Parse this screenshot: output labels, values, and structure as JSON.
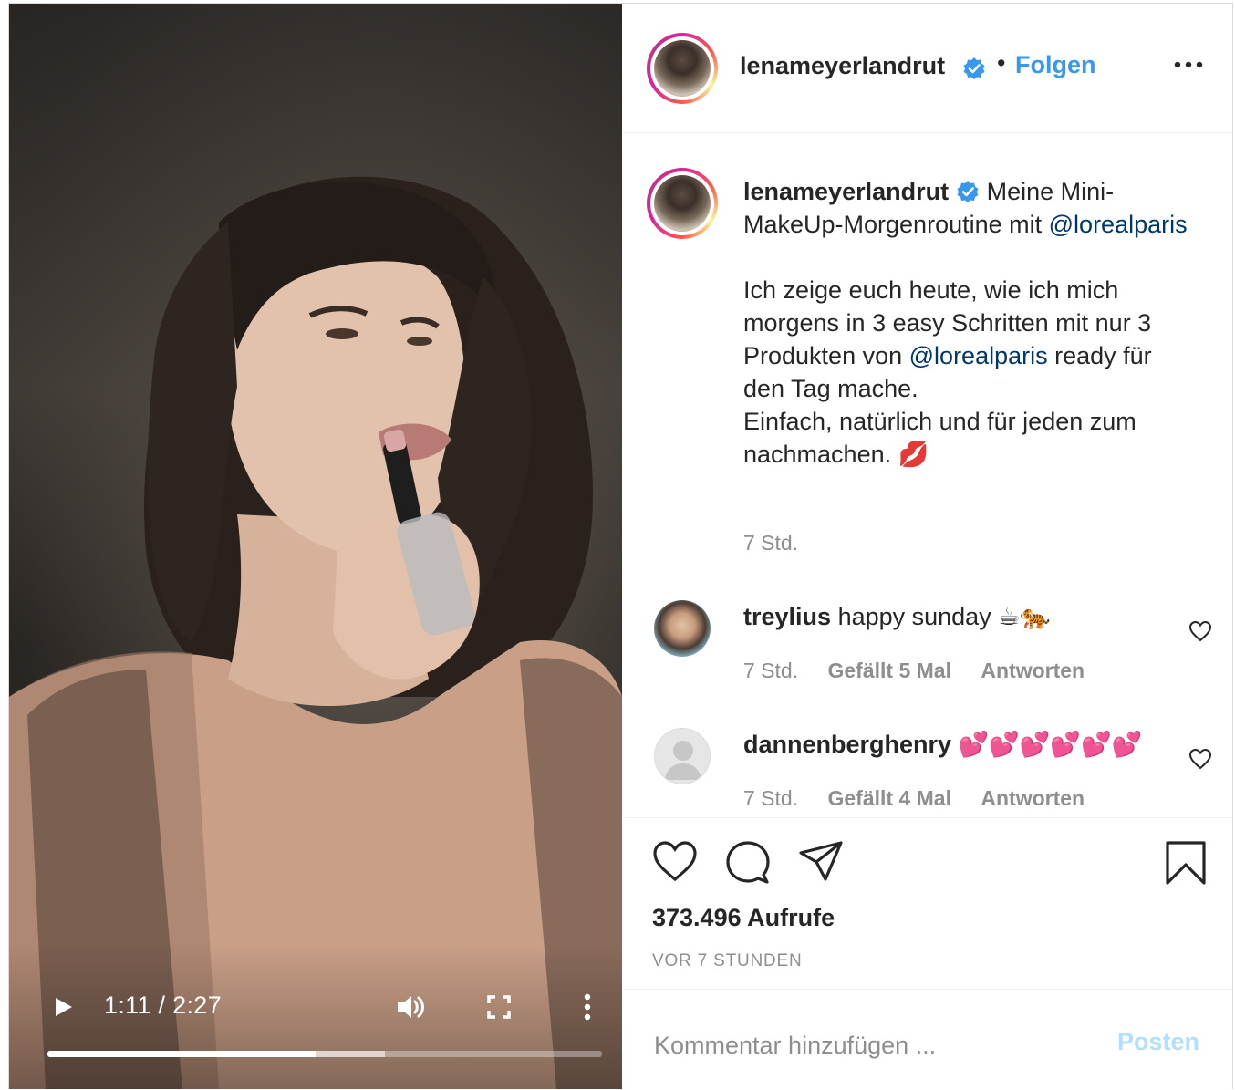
{
  "video": {
    "current_time": "1:11",
    "duration": "2:27",
    "time_display": "1:11 / 2:27",
    "progress_played": 0.484,
    "progress_buffered": 0.609
  },
  "header": {
    "username": "lenameyerlandrut",
    "dot": "•",
    "follow_label": "Folgen"
  },
  "caption": {
    "username": "lenameyerlandrut",
    "line1_before": "Meine Mini-MakeUp-Morgenroutine mit",
    "mention1": "@lorealparis",
    "body_before": "Ich zeige euch heute, wie ich mich morgens in 3 easy Schritten mit nur 3 Produkten von",
    "mention2": "@lorealparis",
    "body_after": "ready für den Tag mache.",
    "body_line2": "Einfach, natürlich und für jeden zum nachmachen. 💋",
    "time": "7 Std."
  },
  "comments": [
    {
      "username": "treylius",
      "text": "happy sunday ☕🐅",
      "time": "7 Std.",
      "likes": "Gefällt 5 Mal",
      "reply": "Antworten"
    },
    {
      "username": "dannenberghenry",
      "text": "💕💕💕💕💕💕",
      "time": "7 Std.",
      "likes": "Gefällt 4 Mal",
      "reply": "Antworten"
    }
  ],
  "stats": {
    "views": "373.496 Aufrufe",
    "ago": "VOR 7 STUNDEN"
  },
  "comment_box": {
    "placeholder": "Kommentar hinzufügen ...",
    "post_label": "Posten"
  },
  "colors": {
    "link_blue": "#3897f0",
    "mention_blue": "#00376b",
    "muted": "#8e8e8e",
    "post_disabled": "#b2dffc"
  },
  "icons": [
    "play-icon",
    "volume-icon",
    "fullscreen-icon",
    "more-vertical-icon",
    "verified-icon",
    "more-horizontal-icon",
    "heart-icon",
    "comment-icon",
    "share-icon",
    "bookmark-icon"
  ]
}
